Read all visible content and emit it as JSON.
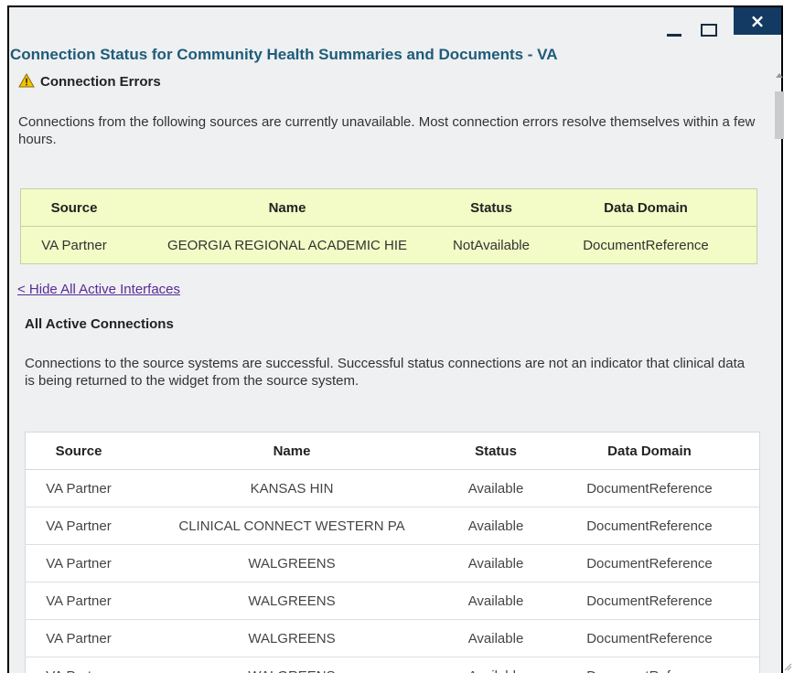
{
  "window": {
    "title": "Connection Status for Community Health Summaries and Documents - VA",
    "controls": {
      "minimize": "minimize-icon",
      "maximize": "maximize-icon",
      "close": "×"
    }
  },
  "errors": {
    "heading": "Connection Errors",
    "icon": "warning-icon",
    "description": "Connections from the following sources are currently unavailable. Most connection errors resolve themselves within a few hours.",
    "table": {
      "headers": [
        "Source",
        "Name",
        "Status",
        "Data Domain"
      ],
      "rows": [
        [
          "VA Partner",
          "GEORGIA REGIONAL ACADEMIC HIE",
          "NotAvailable",
          "DocumentReference"
        ]
      ]
    }
  },
  "toggle_link": "< Hide All Active Interfaces",
  "active": {
    "heading": "All Active Connections",
    "description": "Connections to the source systems are successful. Successful status connections are not an indicator that clinical data is being returned to the widget from the source system.",
    "table": {
      "headers": [
        "Source",
        "Name",
        "Status",
        "Data Domain"
      ],
      "rows": [
        [
          "VA Partner",
          "KANSAS HIN",
          "Available",
          "DocumentReference"
        ],
        [
          "VA Partner",
          "CLINICAL CONNECT WESTERN PA",
          "Available",
          "DocumentReference"
        ],
        [
          "VA Partner",
          "WALGREENS",
          "Available",
          "DocumentReference"
        ],
        [
          "VA Partner",
          "WALGREENS",
          "Available",
          "DocumentReference"
        ],
        [
          "VA Partner",
          "WALGREENS",
          "Available",
          "DocumentReference"
        ],
        [
          "VA Partner",
          "WALGREENS",
          "Available",
          "DocumentReference"
        ]
      ]
    }
  },
  "colors": {
    "title": "#1f5b7a",
    "close_button": "#123a63",
    "error_table_bg": "#f3fbc6",
    "link": "#5a2a96"
  }
}
